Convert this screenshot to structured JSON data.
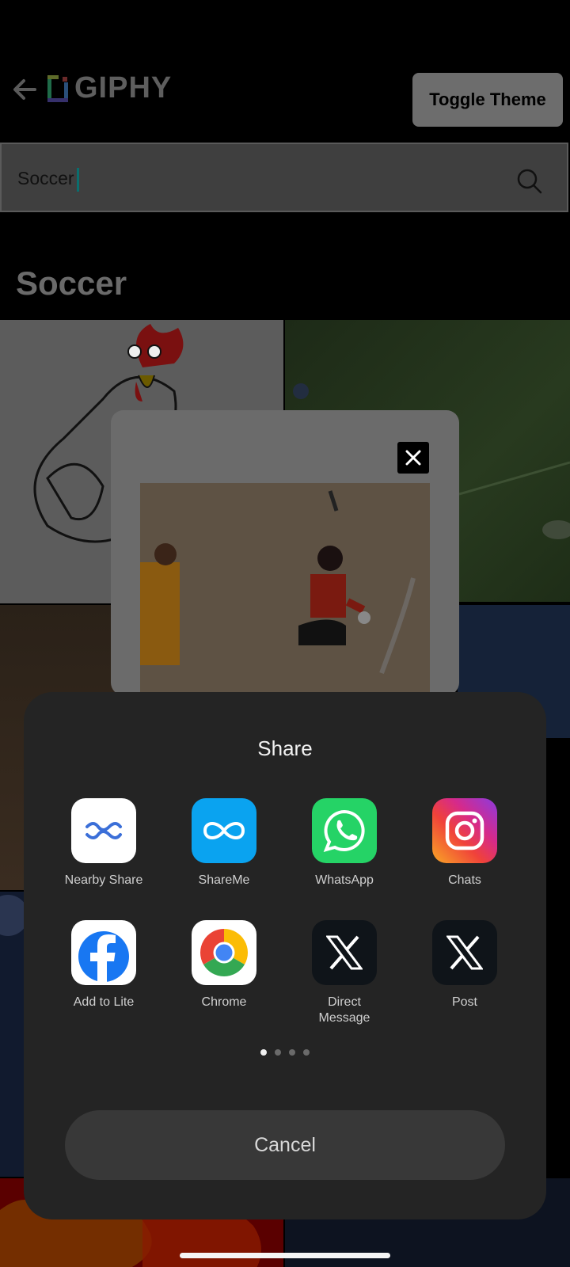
{
  "header": {
    "logo_text": "GIPHY",
    "toggle_label": "Toggle Theme"
  },
  "search": {
    "value": "Soccer"
  },
  "section": {
    "title": "Soccer"
  },
  "share_sheet": {
    "title": "Share",
    "apps": [
      {
        "label": "Nearby Share",
        "icon": "nearby-share-icon"
      },
      {
        "label": "ShareMe",
        "icon": "shareme-icon"
      },
      {
        "label": "WhatsApp",
        "icon": "whatsapp-icon"
      },
      {
        "label": "Chats",
        "icon": "instagram-icon"
      },
      {
        "label": "Add to Lite",
        "icon": "facebook-lite-icon"
      },
      {
        "label": "Chrome",
        "icon": "chrome-icon"
      },
      {
        "label": "Direct\nMessage",
        "icon": "x-icon"
      },
      {
        "label": "Post",
        "icon": "x-icon"
      }
    ],
    "page_count": 4,
    "active_page": 1,
    "cancel_label": "Cancel"
  },
  "colors": {
    "sheet_bg": "#242424",
    "whatsapp": "#25D366",
    "shareme": "#0aa3f0",
    "chrome_red": "#EA4335",
    "chrome_yellow": "#FBBC05",
    "chrome_green": "#34A853",
    "chrome_blue": "#4285F4",
    "facebook": "#1877F2"
  }
}
